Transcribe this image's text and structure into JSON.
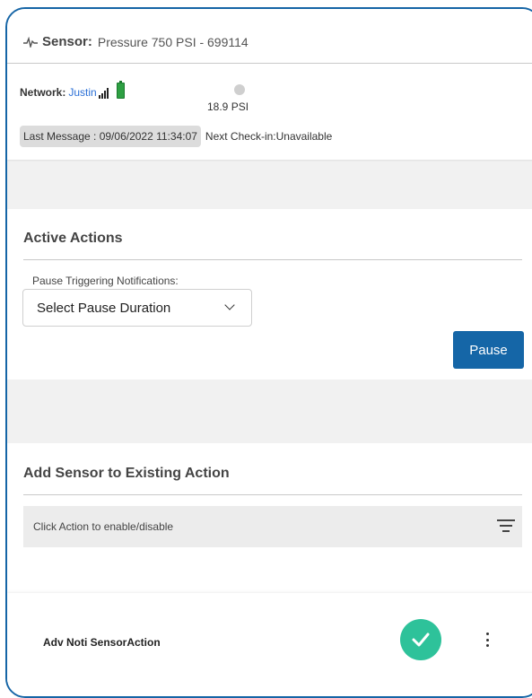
{
  "sensor": {
    "label": "Sensor:",
    "name": "Pressure 750 PSI - 699114",
    "network_label": "Network:",
    "network_value": "Justin",
    "reading": "18.9 PSI",
    "last_message": "Last Message : 09/06/2022 11:34:07",
    "next_checkin": "Next Check-in:Unavailable",
    "icons": {
      "status": "pulse-icon",
      "signal": "signal-strength-icon",
      "battery": "battery-icon"
    },
    "battery_color": "#2ea043"
  },
  "active_actions": {
    "title": "Active Actions",
    "pause_label": "Pause Triggering Notifications:",
    "select_value": "Select Pause Duration",
    "pause_button": "Pause"
  },
  "existing_action": {
    "title": "Add Sensor to Existing Action",
    "filter_text": "Click Action to enable/disable",
    "items": [
      {
        "name": "Adv Noti SensorAction",
        "enabled": true
      }
    ]
  },
  "colors": {
    "accent": "#1566a7",
    "toggle_on": "#2ec29a",
    "link": "#2a6fd6"
  }
}
